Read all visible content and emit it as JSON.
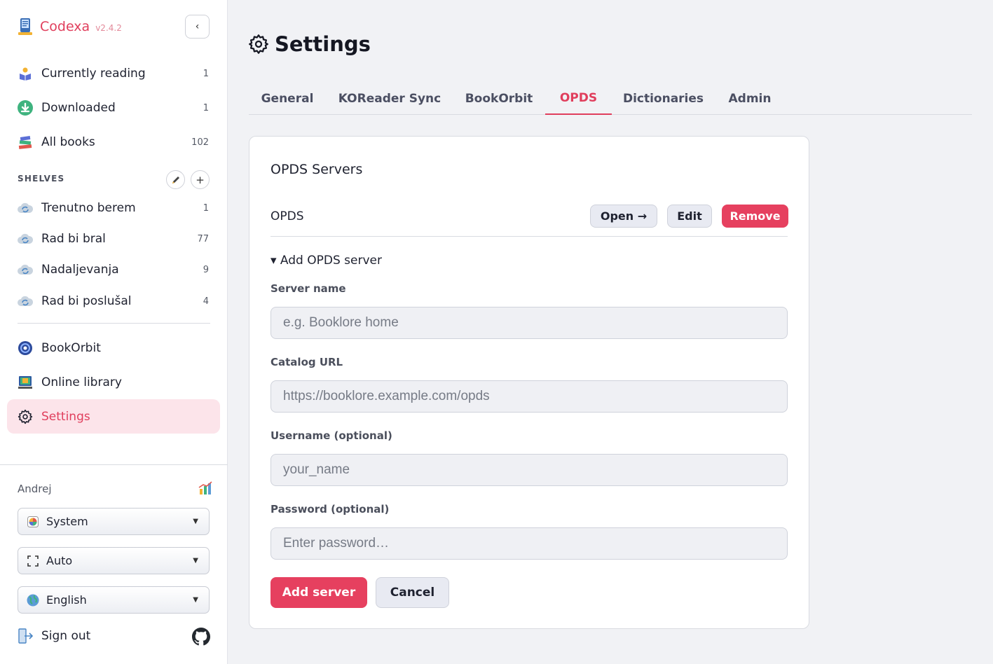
{
  "app": {
    "name": "Codexa",
    "version": "v2.4.2"
  },
  "sidebar": {
    "nav": [
      {
        "label": "Currently reading",
        "count": "1"
      },
      {
        "label": "Downloaded",
        "count": "1"
      },
      {
        "label": "All books",
        "count": "102"
      }
    ],
    "shelves_heading": "SHELVES",
    "shelves": [
      {
        "label": "Trenutno berem",
        "count": "1"
      },
      {
        "label": "Rad bi bral",
        "count": "77"
      },
      {
        "label": "Nadaljevanja",
        "count": "9"
      },
      {
        "label": "Rad bi poslušal",
        "count": "4"
      }
    ],
    "links": [
      {
        "label": "BookOrbit"
      },
      {
        "label": "Online library"
      },
      {
        "label": "Settings"
      }
    ],
    "user": "Andrej",
    "selects": [
      {
        "value": "System"
      },
      {
        "value": "Auto"
      },
      {
        "value": "English"
      }
    ],
    "sign_out": "Sign out"
  },
  "page": {
    "title": "Settings"
  },
  "tabs": [
    "General",
    "KOReader Sync",
    "BookOrbit",
    "OPDS",
    "Dictionaries",
    "Admin"
  ],
  "active_tab": "OPDS",
  "opds": {
    "card_title": "OPDS Servers",
    "server": {
      "name": "OPDS",
      "open_label": "Open →",
      "edit_label": "Edit",
      "remove_label": "Remove"
    },
    "add_summary": "▾ Add OPDS server",
    "fields": {
      "server_name": {
        "label": "Server name",
        "placeholder": "e.g. Booklore home"
      },
      "catalog_url": {
        "label": "Catalog URL",
        "placeholder": "https://booklore.example.com/opds"
      },
      "username": {
        "label": "Username (optional)",
        "placeholder": "your_name"
      },
      "password": {
        "label": "Password (optional)",
        "placeholder": "Enter password…"
      }
    },
    "add_button": "Add server",
    "cancel_button": "Cancel"
  },
  "colors": {
    "accent": "#e03e5c",
    "accent_bg": "#fce4ea",
    "danger": "#e6405f"
  }
}
